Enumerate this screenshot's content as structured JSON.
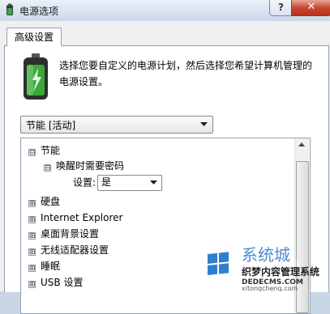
{
  "window": {
    "title": "电源选项",
    "help": "?",
    "close": "✕"
  },
  "tabs": [
    {
      "label": "高级设置"
    }
  ],
  "description": "选择您要自定义的电源计划，然后选择您希望计算机管理的电源设置。",
  "plan_select": {
    "value": "节能 [活动]"
  },
  "tree": {
    "root": {
      "expander": "⊟",
      "label": "节能"
    },
    "child": {
      "expander": "⊟",
      "label": "唤醒时需要密码"
    },
    "setting": {
      "label": "设置:",
      "value": "是"
    },
    "items": [
      {
        "expander": "⊞",
        "label": "硬盘"
      },
      {
        "expander": "⊞",
        "label": "Internet Explorer"
      },
      {
        "expander": "⊞",
        "label": "桌面背景设置"
      },
      {
        "expander": "⊞",
        "label": "无线适配器设置"
      },
      {
        "expander": "⊞",
        "label": "睡眠"
      },
      {
        "expander": "⊞",
        "label": "USB 设置"
      }
    ]
  },
  "watermark": {
    "brand": "系统城",
    "cn_text": "织梦内容管理系统",
    "domain1": "DEDECMS.COM",
    "domain2": "xitongcheng.com"
  },
  "colors": {
    "titlebar": "#d7e3f0",
    "close": "#c8452e",
    "battery_green": "#3aa83a",
    "tab_border": "#8e9fb5"
  }
}
